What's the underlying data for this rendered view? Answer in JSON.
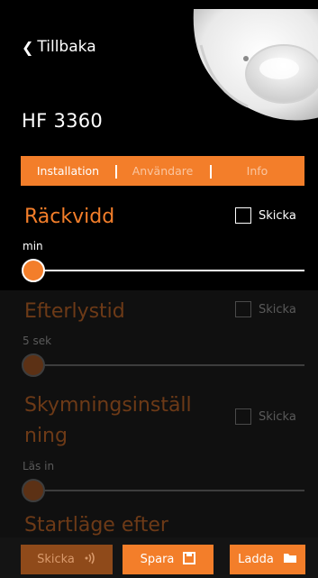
{
  "header": {
    "back_label": "Tillbaka",
    "title": "HF 3360"
  },
  "tabs": [
    {
      "label": "Installation"
    },
    {
      "label": "Användare"
    },
    {
      "label": "Info"
    }
  ],
  "settings": [
    {
      "title": "Räckvidd",
      "send_label": "Skicka",
      "value": "min"
    },
    {
      "title": "Efterlystid",
      "send_label": "Skicka",
      "value": "5 sek"
    },
    {
      "title_line1": "Skymningsinställ",
      "title_line2": "ning",
      "send_label": "Skicka",
      "value": "Läs in"
    },
    {
      "title": "Startläge efter"
    }
  ],
  "footer": {
    "send_label": "Skicka",
    "save_label": "Spara",
    "load_label": "Ladda"
  },
  "colors": {
    "accent": "#f37e2a",
    "background": "#000000"
  }
}
